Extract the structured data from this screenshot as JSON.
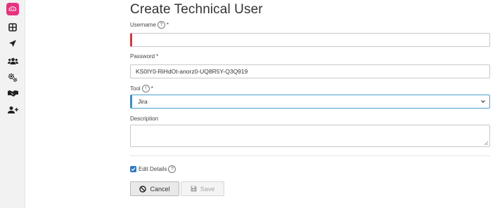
{
  "page": {
    "title": "Create Technical User"
  },
  "sidebar": {
    "items": [
      {
        "icon": "logo-icon"
      },
      {
        "icon": "dashboard-icon"
      },
      {
        "icon": "paper-plane-icon"
      },
      {
        "icon": "users-icon"
      },
      {
        "icon": "cogs-icon"
      },
      {
        "icon": "handshake-icon"
      },
      {
        "icon": "user-plus-icon"
      }
    ]
  },
  "form": {
    "username": {
      "label": "Username",
      "help": "?",
      "required_mark": "*",
      "value": ""
    },
    "password": {
      "label": "Password",
      "required_mark": "*",
      "value": "KS0IY0-RiHdOt-anorz0-UQ8R5Y-Q3Q919"
    },
    "tool": {
      "label": "Tool",
      "help": "!",
      "required_mark": "*",
      "selected": "Jira"
    },
    "description": {
      "label": "Description",
      "value": ""
    },
    "edit_details": {
      "label": "Edit Details",
      "help": "?",
      "checked": true
    }
  },
  "buttons": {
    "cancel": "Cancel",
    "save": "Save"
  },
  "colors": {
    "accent": "#e5337f",
    "invalid": "#d9363e",
    "focus": "#3d8ec9",
    "checkbox": "#2f78c4"
  }
}
